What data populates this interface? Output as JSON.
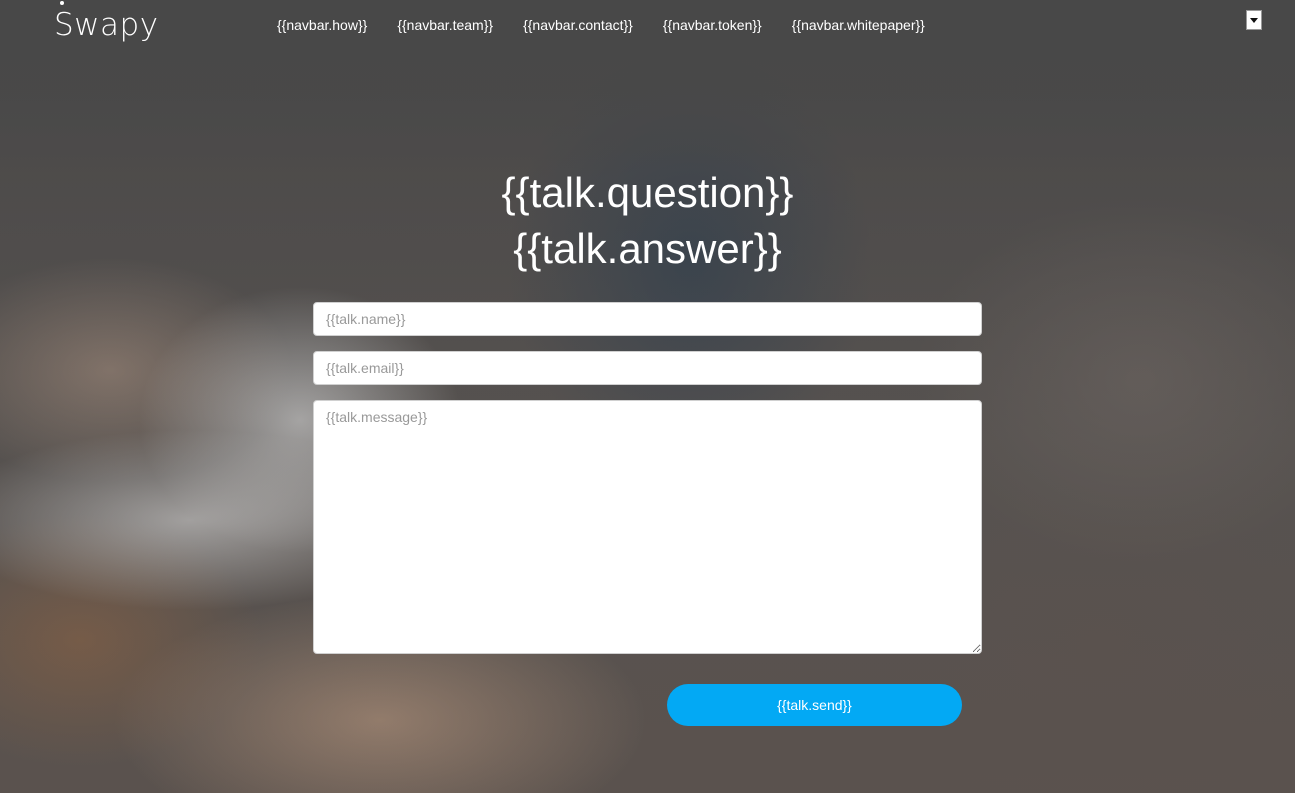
{
  "brand": {
    "logo_text": "Swapy"
  },
  "navbar": {
    "links": [
      {
        "label": "{{navbar.how}}"
      },
      {
        "label": "{{navbar.team}}"
      },
      {
        "label": "{{navbar.contact}}"
      },
      {
        "label": "{{navbar.token}}"
      },
      {
        "label": "{{navbar.whitepaper}}"
      }
    ],
    "language_select_value": ""
  },
  "talk": {
    "question": "{{talk.question}}",
    "answer": "{{talk.answer}}",
    "name_placeholder": "{{talk.name}}",
    "email_placeholder": "{{talk.email}}",
    "message_placeholder": "{{talk.message}}",
    "send_label": "{{talk.send}}"
  },
  "colors": {
    "accent": "#03a9f4",
    "text_light": "#ffffff"
  }
}
